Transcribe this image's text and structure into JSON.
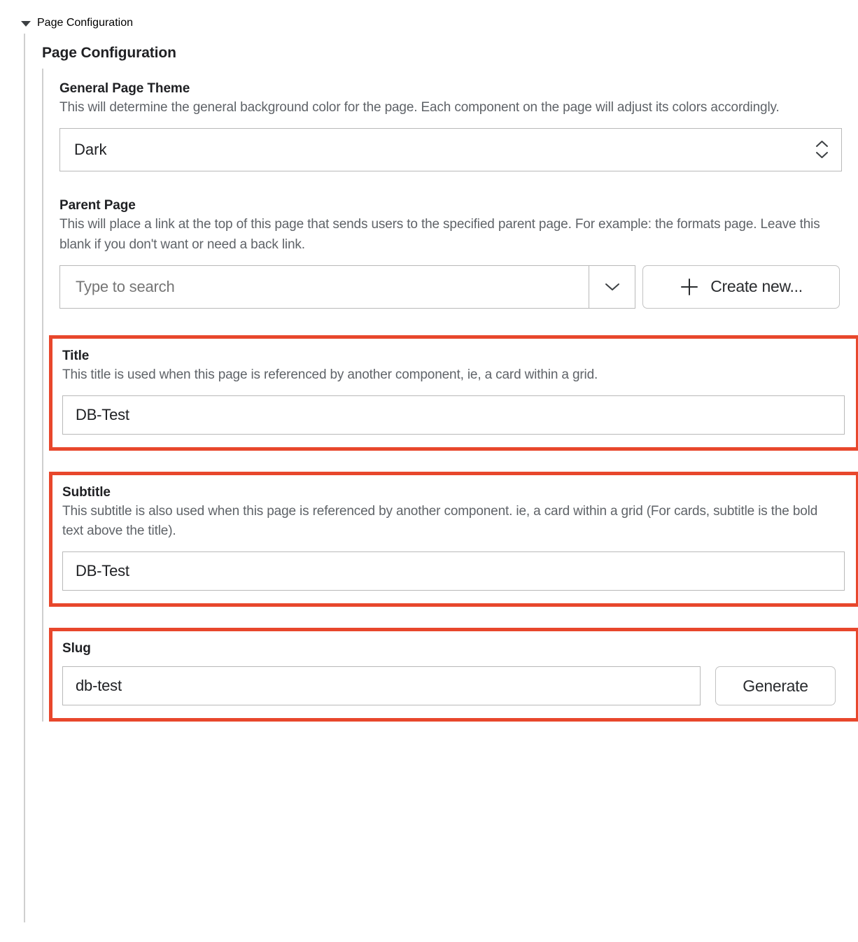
{
  "disclosure": {
    "label": "Page Configuration",
    "expanded": true,
    "icon": "triangle-down-icon"
  },
  "group": {
    "title": "Page Configuration"
  },
  "theme_colors": {
    "highlight_red": "#e8472c",
    "text_primary": "#1f2023",
    "text_secondary": "#5f6368",
    "border_gray": "#b9b9b9",
    "rail_gray": "#cfcfcf"
  },
  "fields": {
    "general_page_theme": {
      "label": "General Page Theme",
      "description": "This will determine the general background color for the page. Each component on the page will adjust its colors accordingly.",
      "value": "Dark",
      "options": [
        "Dark"
      ],
      "spinner_icon": "chevron-up-down-icon",
      "highlighted": false
    },
    "parent_page": {
      "label": "Parent Page",
      "description": "This will place a link at the top of this page that sends users to the specified parent page. For example: the formats page. Leave this blank if you don't want or need a back link.",
      "value": "",
      "placeholder": "Type to search",
      "dropdown_icon": "chevron-down-icon",
      "create_button": {
        "label": "Create new...",
        "icon": "plus-icon"
      },
      "highlighted": false
    },
    "title": {
      "label": "Title",
      "description": "This title is used when this page is referenced by another component, ie, a card within a grid.",
      "value": "DB-Test",
      "highlighted": true
    },
    "subtitle": {
      "label": "Subtitle",
      "description": "This subtitle is also used when this page is referenced by another component. ie, a card within a grid (For cards, subtitle is the bold text above the title).",
      "value": "DB-Test",
      "highlighted": true
    },
    "slug": {
      "label": "Slug",
      "value": "db-test",
      "generate_button": {
        "label": "Generate"
      },
      "highlighted": true
    }
  }
}
